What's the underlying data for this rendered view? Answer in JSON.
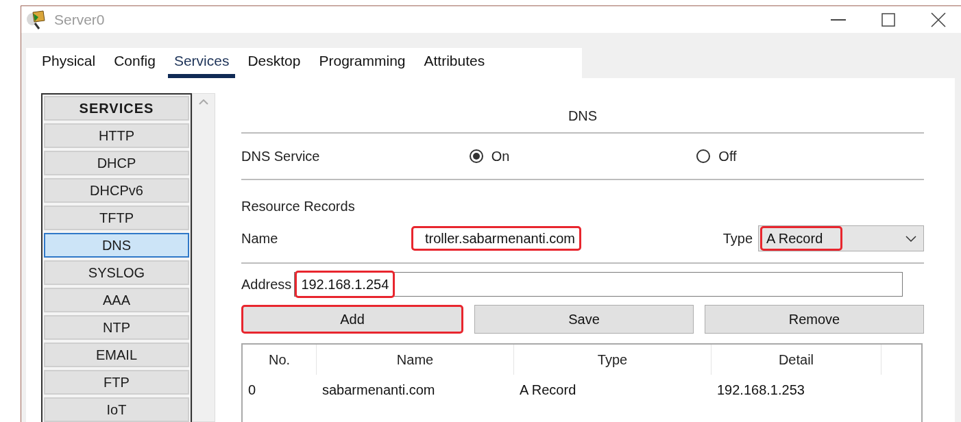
{
  "window": {
    "title": "Server0"
  },
  "tabs": [
    {
      "label": "Physical",
      "selected": false
    },
    {
      "label": "Config",
      "selected": false
    },
    {
      "label": "Services",
      "selected": true
    },
    {
      "label": "Desktop",
      "selected": false
    },
    {
      "label": "Programming",
      "selected": false
    },
    {
      "label": "Attributes",
      "selected": false
    }
  ],
  "sidebar": {
    "heading": "SERVICES",
    "items": [
      {
        "label": "HTTP",
        "selected": false
      },
      {
        "label": "DHCP",
        "selected": false
      },
      {
        "label": "DHCPv6",
        "selected": false
      },
      {
        "label": "TFTP",
        "selected": false
      },
      {
        "label": "DNS",
        "selected": true
      },
      {
        "label": "SYSLOG",
        "selected": false
      },
      {
        "label": "AAA",
        "selected": false
      },
      {
        "label": "NTP",
        "selected": false
      },
      {
        "label": "EMAIL",
        "selected": false
      },
      {
        "label": "FTP",
        "selected": false
      },
      {
        "label": "IoT",
        "selected": false
      }
    ]
  },
  "dns": {
    "title": "DNS",
    "service_label": "DNS Service",
    "options": [
      {
        "label": "On",
        "selected": true
      },
      {
        "label": "Off",
        "selected": false
      }
    ],
    "records_heading": "Resource Records",
    "name": {
      "label": "Name",
      "value": "troller.sabarmenanti.com",
      "highlighted": true
    },
    "type": {
      "label": "Type",
      "value": "A Record",
      "highlighted": true
    },
    "address": {
      "label": "Address",
      "value": "192.168.1.254",
      "highlighted": true
    },
    "buttons": [
      {
        "label": "Add",
        "highlighted": true
      },
      {
        "label": "Save",
        "highlighted": false
      },
      {
        "label": "Remove",
        "highlighted": false
      }
    ],
    "table": {
      "columns": [
        "No.",
        "Name",
        "Type",
        "Detail"
      ],
      "rows": [
        [
          "0",
          "sabarmenanti.com",
          "A Record",
          "192.168.1.253"
        ]
      ]
    }
  }
}
